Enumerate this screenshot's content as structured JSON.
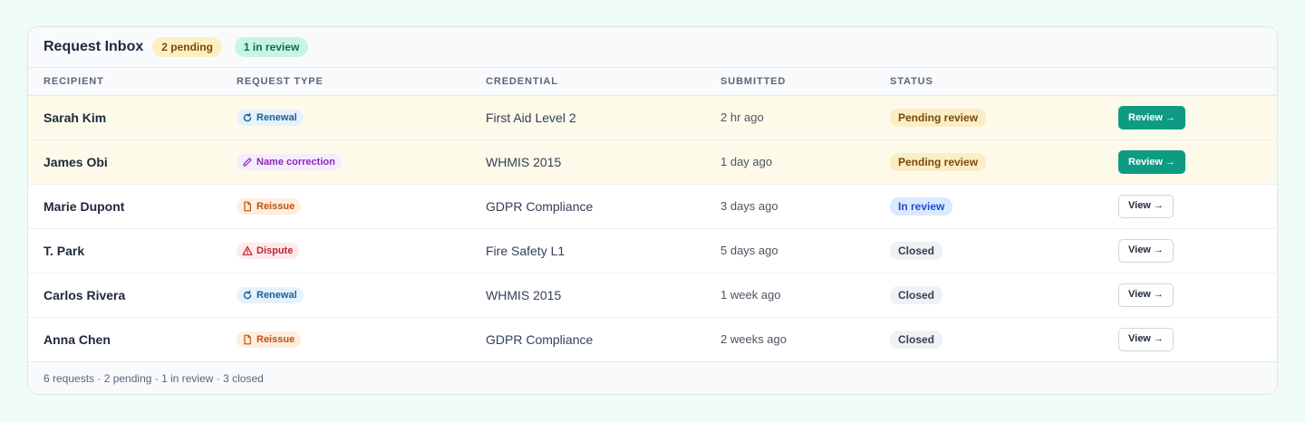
{
  "header": {
    "title": "Request Inbox",
    "pending_pill": "2 pending",
    "review_pill": "1 in review"
  },
  "columns": [
    "RECIPIENT",
    "REQUEST TYPE",
    "CREDENTIAL",
    "SUBMITTED",
    "STATUS",
    ""
  ],
  "rows": [
    {
      "recipient": "Sarah Kim",
      "type": "Renewal",
      "type_icon": "refresh-icon",
      "credential": "First Aid Level 2",
      "submitted": "2 hr ago",
      "status": "Pending review",
      "action": "Review →"
    },
    {
      "recipient": "James Obi",
      "type": "Name correction",
      "type_icon": "pencil-icon",
      "credential": "WHMIS 2015",
      "submitted": "1 day ago",
      "status": "Pending review",
      "action": "Review →"
    },
    {
      "recipient": "Marie Dupont",
      "type": "Reissue",
      "type_icon": "document-icon",
      "credential": "GDPR Compliance",
      "submitted": "3 days ago",
      "status": "In review",
      "action": "View →"
    },
    {
      "recipient": "T. Park",
      "type": "Dispute",
      "type_icon": "warning-icon",
      "credential": "Fire Safety L1",
      "submitted": "5 days ago",
      "status": "Closed",
      "action": "View →"
    },
    {
      "recipient": "Carlos Rivera",
      "type": "Renewal",
      "type_icon": "refresh-icon",
      "credential": "WHMIS 2015",
      "submitted": "1 week ago",
      "status": "Closed",
      "action": "View →"
    },
    {
      "recipient": "Anna Chen",
      "type": "Reissue",
      "type_icon": "document-icon",
      "credential": "GDPR Compliance",
      "submitted": "2 weeks ago",
      "status": "Closed",
      "action": "View →"
    }
  ],
  "footer": {
    "summary": "6 requests · 2 pending · 1 in review · 3 closed"
  },
  "colors": {
    "accent": "#0f9a84",
    "pending_row": "#fefaea",
    "background": "#effbf7"
  }
}
